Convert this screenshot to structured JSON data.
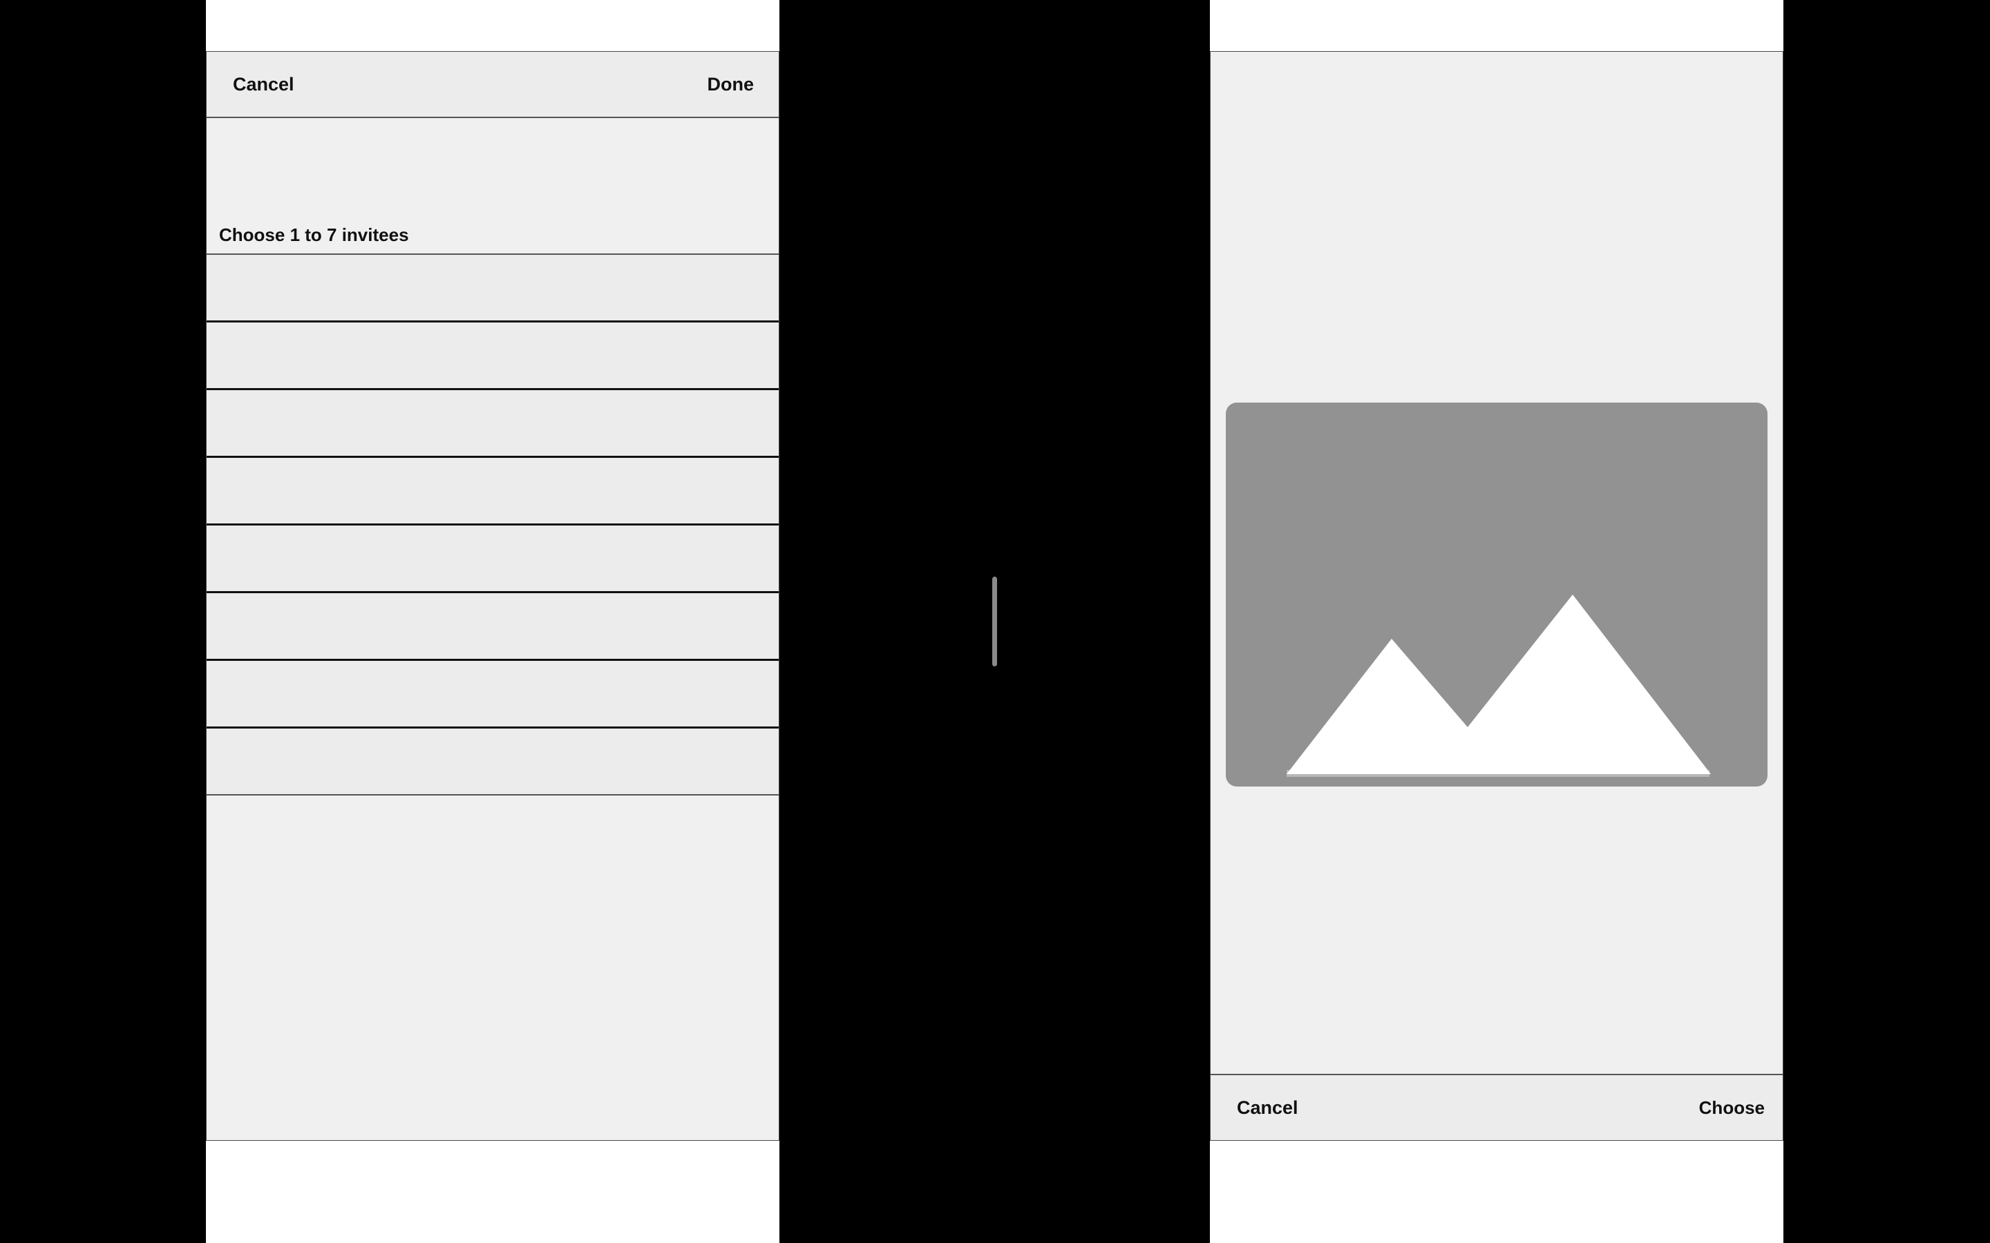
{
  "left_sheet": {
    "cancel_label": "Cancel",
    "done_label": "Done",
    "section_label": "Choose 1 to 7 invitees",
    "rows": [
      "",
      "",
      "",
      "",
      "",
      "",
      "",
      ""
    ]
  },
  "right_sheet": {
    "image_icon": "image-placeholder-icon",
    "cancel_label": "Cancel",
    "choose_label": "Choose"
  },
  "colors": {
    "background": "#000000",
    "sheet": "#f0f0f0",
    "bar": "#ececec",
    "placeholder": "#929292"
  }
}
